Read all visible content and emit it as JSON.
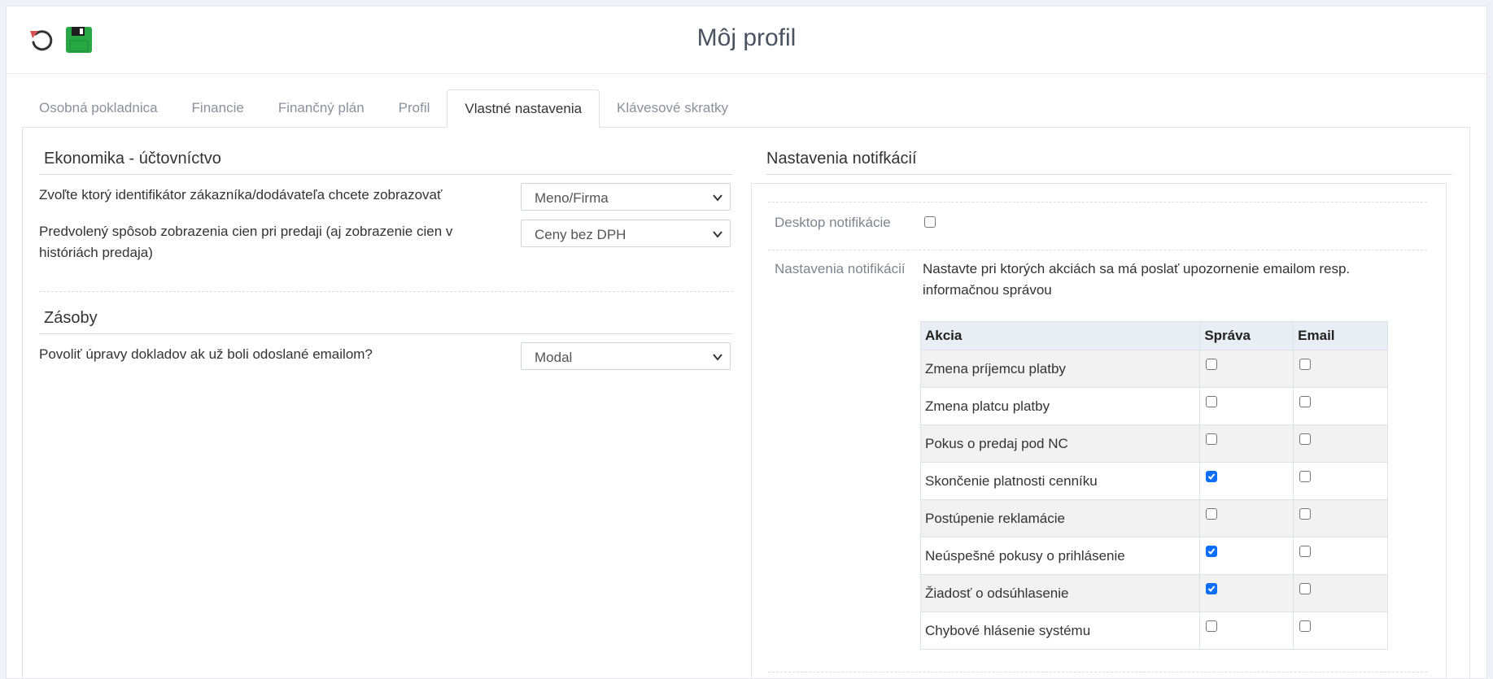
{
  "header": {
    "title": "Môj profil",
    "undo_icon": "undo-icon",
    "save_icon": "floppy-disk-icon"
  },
  "tabs": [
    {
      "label": "Osobná pokladnica",
      "active": false
    },
    {
      "label": "Financie",
      "active": false
    },
    {
      "label": "Finančný plán",
      "active": false
    },
    {
      "label": "Profil",
      "active": false
    },
    {
      "label": "Vlastné nastavenia",
      "active": true
    },
    {
      "label": "Klávesové skratky",
      "active": false
    }
  ],
  "economics": {
    "title": "Ekonomika - účtovníctvo",
    "fields": [
      {
        "label": "Zvoľte ktorý identifikátor zákazníka/dodávateľa chcete zobrazovať",
        "value": "Meno/Firma"
      },
      {
        "label": "Predvolený spôsob zobrazenia cien pri predaji (aj zobrazenie cien v históriách predaja)",
        "value": "Ceny bez DPH"
      }
    ]
  },
  "stock": {
    "title": "Zásoby",
    "fields": [
      {
        "label": "Povoliť úpravy dokladov ak už boli odoslané emailom?",
        "value": "Modal"
      }
    ]
  },
  "notifications": {
    "title": "Nastavenia notifkácií",
    "desktop_label": "Desktop notifikácie",
    "desktop_checked": false,
    "settings_label": "Nastavenia notifikácií",
    "settings_description": "Nastavte pri ktorých akciách sa má poslať upozornenie emailom resp. informačnou správou",
    "table": {
      "headers": [
        "Akcia",
        "Správa",
        "Email"
      ],
      "rows": [
        {
          "action": "Zmena príjemcu platby",
          "message": false,
          "email": false
        },
        {
          "action": "Zmena platcu platby",
          "message": false,
          "email": false
        },
        {
          "action": "Pokus o predaj pod NC",
          "message": false,
          "email": false
        },
        {
          "action": "Skončenie platnosti cenníku",
          "message": true,
          "email": false
        },
        {
          "action": "Postúpenie reklamácie",
          "message": false,
          "email": false
        },
        {
          "action": "Neúspešné pokusy o prihlásenie",
          "message": true,
          "email": false
        },
        {
          "action": "Žiadosť o odsúhlasenie",
          "message": true,
          "email": false
        },
        {
          "action": "Chybové hlásenie systému",
          "message": false,
          "email": false
        }
      ]
    }
  },
  "colors": {
    "accent": "#0d6efd",
    "save_green": "#28a745",
    "undo_red": "#d9534f"
  }
}
